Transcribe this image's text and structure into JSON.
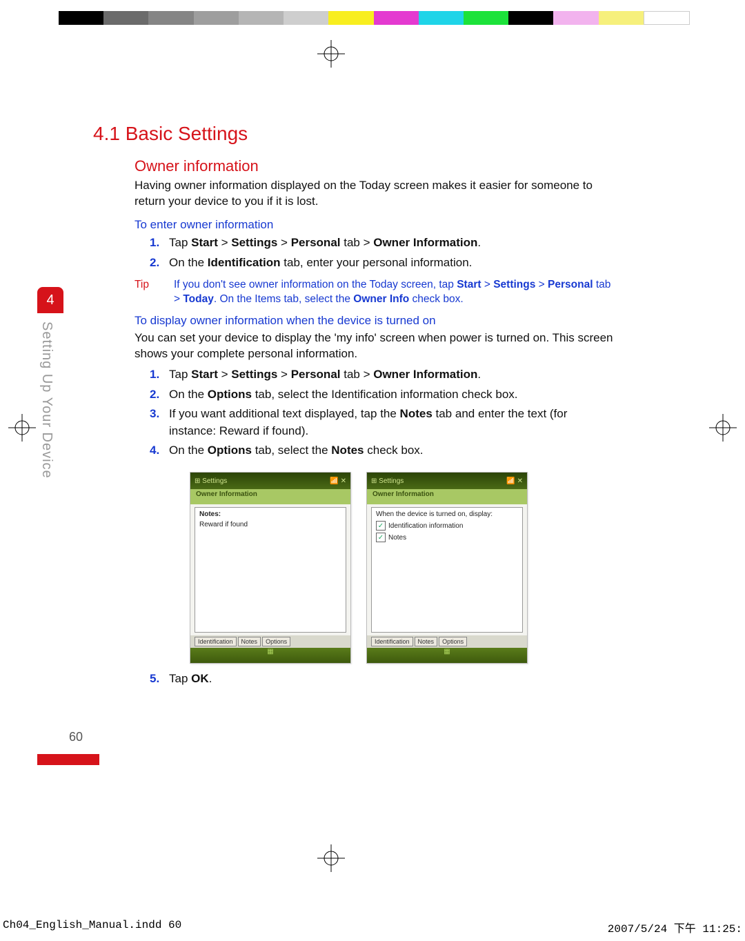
{
  "colorbar_colors": [
    "#000",
    "#6b6b6b",
    "#858585",
    "#9e9e9e",
    "#b5b5b5",
    "#cecece",
    "#f8ee1f",
    "#e43ad0",
    "#1fd4e8",
    "#1ce23a",
    "#000",
    "#f2b3ee",
    "#f6f07c",
    "#fff"
  ],
  "section": {
    "number": "4.1",
    "title": "Basic Settings"
  },
  "h2": "Owner information",
  "para1": "Having owner information displayed on the Today screen makes it easier for someone to return your device to you if it is lost.",
  "sub1": "To enter owner information",
  "steps1": [
    {
      "pre": "Tap ",
      "b1": "Start",
      "m1": " > ",
      "b2": "Settings",
      "m2": " > ",
      "b3": "Personal",
      "m3": " tab > ",
      "b4": "Owner Information",
      "post": "."
    },
    {
      "pre": "On the ",
      "b1": "Identiﬁcation",
      "post": " tab, enter your personal information."
    }
  ],
  "tip": {
    "label": "Tip",
    "text_a": "If you don't see owner information on the Today screen, tap ",
    "b1": "Start",
    "m1": " > ",
    "b2": "Settings",
    "m2": " > ",
    "b3": "Personal",
    "m3": " tab > ",
    "b4": "Today",
    "text_b": ". On the Items tab, select the ",
    "b5": "Owner Info",
    "text_c": " check box."
  },
  "sub2": "To display owner information when the device is turned on",
  "para2": "You can set your device to display the 'my info' screen when power is turned on. This screen shows your complete personal information.",
  "steps2": [
    {
      "pre": "Tap ",
      "b1": "Start",
      "m1": " > ",
      "b2": "Settings",
      "m2": " > ",
      "b3": "Personal",
      "m3": " tab > ",
      "b4": "Owner Information",
      "post": "."
    },
    {
      "pre": "On the ",
      "b1": "Options",
      "post": " tab, select the Identification information check box."
    },
    {
      "pre": "If you want additional text displayed, tap the ",
      "b1": "Notes",
      "post": " tab and enter the text (for instance: Reward if found)."
    },
    {
      "pre": "On the ",
      "b1": "Options",
      "m1": " tab, select the ",
      "b2": "Notes",
      "post": " check box."
    }
  ],
  "step5": {
    "pre": "Tap ",
    "b1": "OK",
    "post": "."
  },
  "screens": {
    "left": {
      "title": "Owner Information",
      "body_label": "Notes:",
      "body_text": "Reward if found",
      "tabs": [
        "Identification",
        "Notes",
        "Options"
      ]
    },
    "right": {
      "title": "Owner Information",
      "body_label": "When the device is turned on, display:",
      "chk1": "Identification information",
      "chk2": "Notes",
      "tabs": [
        "Identification",
        "Notes",
        "Options"
      ]
    }
  },
  "side": {
    "chapter": "4",
    "label": "Setting Up Your Device"
  },
  "page_number": "60",
  "footer": {
    "left": "Ch04_English_Manual.indd   60",
    "right": "2007/5/24   下午 11:25:"
  }
}
